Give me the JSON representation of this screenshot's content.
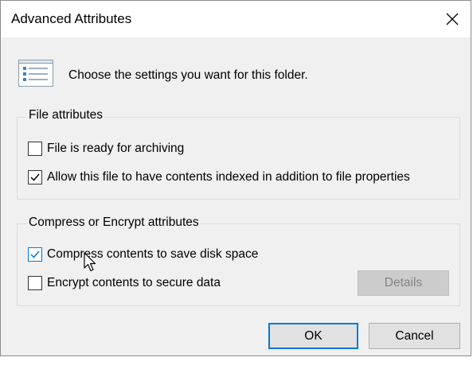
{
  "window": {
    "title": "Advanced Attributes",
    "close_icon": "close-icon"
  },
  "header": {
    "icon": "settings-list-icon",
    "text": "Choose the settings you want for this folder."
  },
  "file_attributes": {
    "title": "File attributes",
    "options": [
      {
        "label": "File is ready for archiving",
        "checked": false
      },
      {
        "label": "Allow this file to have contents indexed in addition to file properties",
        "checked": true
      }
    ]
  },
  "compress_encrypt": {
    "title": "Compress or Encrypt attributes",
    "options": [
      {
        "label": "Compress contents to save disk space",
        "checked": true
      },
      {
        "label": "Encrypt contents to secure data",
        "checked": false
      }
    ],
    "details_label": "Details",
    "details_enabled": false
  },
  "buttons": {
    "ok_label": "OK",
    "cancel_label": "Cancel"
  },
  "colors": {
    "accent": "#0078d7",
    "checkmark": "#000000"
  }
}
